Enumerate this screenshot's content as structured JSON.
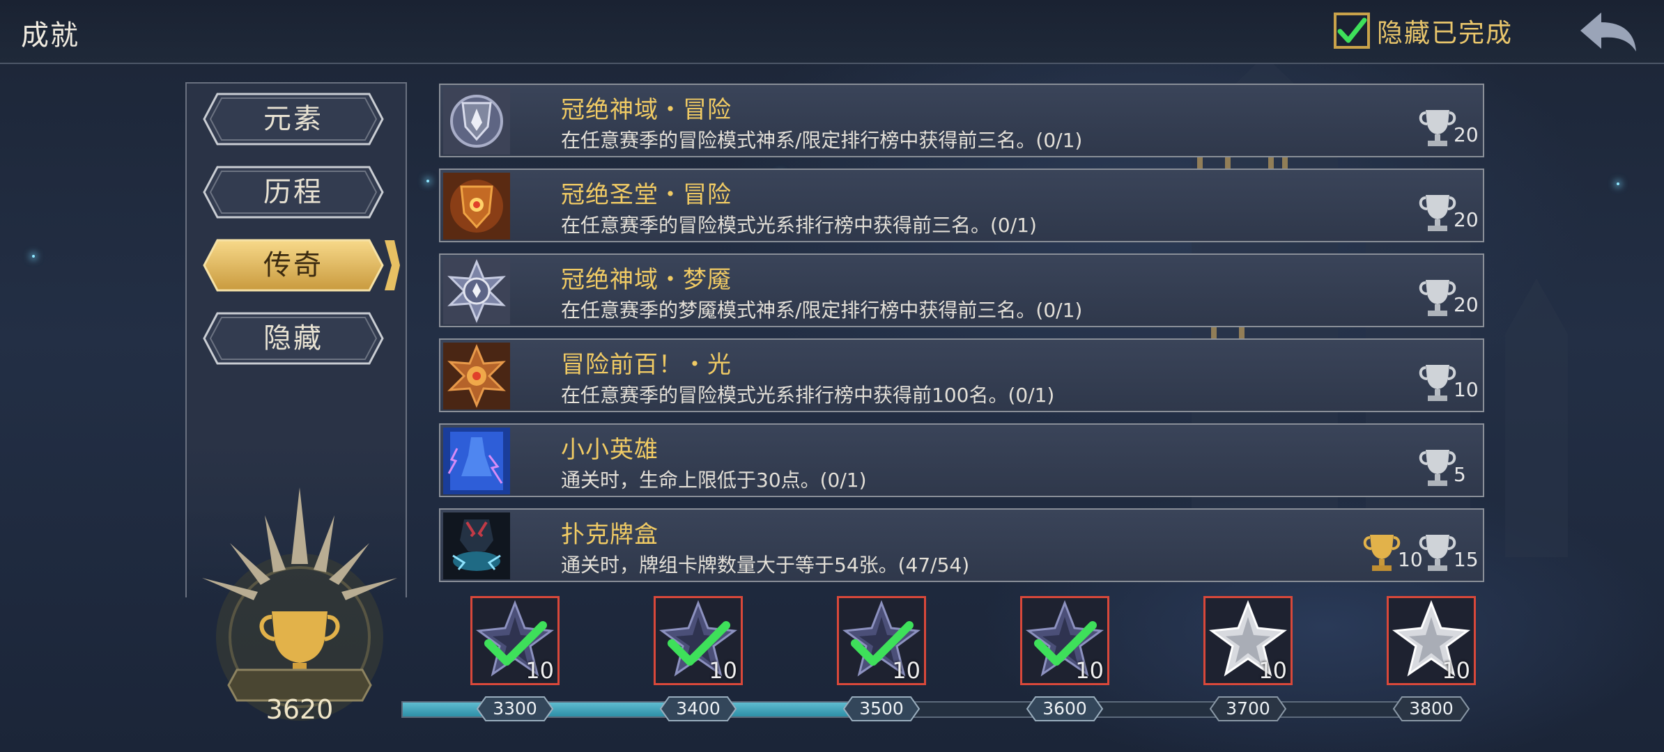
{
  "header": {
    "title": "成就",
    "hide_completed_label": "隐藏已完成",
    "hide_completed_checked": true
  },
  "categories": [
    {
      "label": "元素",
      "active": false
    },
    {
      "label": "历程",
      "active": false
    },
    {
      "label": "传奇",
      "active": true
    },
    {
      "label": "隐藏",
      "active": false
    }
  ],
  "total_score": "3620",
  "achievements": [
    {
      "name": "冠绝神域・冒险",
      "desc": "在任意赛季的冒险模式神系/限定排行榜中获得前三名。(0/1)",
      "icon": "divine-shield-medal-icon",
      "rewards": [
        {
          "type": "silver-trophy",
          "value": "20"
        }
      ]
    },
    {
      "name": "冠绝圣堂・冒险",
      "desc": "在任意赛季的冒险模式光系排行榜中获得前三名。(0/1)",
      "icon": "holy-shield-medal-icon",
      "rewards": [
        {
          "type": "silver-trophy",
          "value": "20"
        }
      ]
    },
    {
      "name": "冠绝神域・梦魇",
      "desc": "在任意赛季的梦魇模式神系/限定排行榜中获得前三名。(0/1)",
      "icon": "divine-star-medal-icon",
      "rewards": [
        {
          "type": "silver-trophy",
          "value": "20"
        }
      ]
    },
    {
      "name": "冒险前百！・光",
      "desc": "在任意赛季的冒险模式光系排行榜中获得前100名。(0/1)",
      "icon": "light-star-medal-icon",
      "rewards": [
        {
          "type": "silver-trophy",
          "value": "10"
        }
      ]
    },
    {
      "name": "小小英雄",
      "desc": "通关时，生命上限低于30点。(0/1)",
      "icon": "little-hero-card-icon",
      "rewards": [
        {
          "type": "silver-trophy",
          "value": "5"
        }
      ]
    },
    {
      "name": "扑克牌盒",
      "desc": "通关时，牌组卡牌数量大于等于54张。(47/54)",
      "icon": "card-box-icon",
      "rewards": [
        {
          "type": "gold-trophy",
          "value": "10"
        },
        {
          "type": "silver-trophy",
          "value": "15"
        }
      ]
    }
  ],
  "milestones": [
    {
      "threshold": "3300",
      "reward": "10",
      "claimed": true
    },
    {
      "threshold": "3400",
      "reward": "10",
      "claimed": true
    },
    {
      "threshold": "3500",
      "reward": "10",
      "claimed": true
    },
    {
      "threshold": "3600",
      "reward": "10",
      "claimed": true
    },
    {
      "threshold": "3700",
      "reward": "10",
      "claimed": false
    },
    {
      "threshold": "3800",
      "reward": "10",
      "claimed": false
    }
  ],
  "progress_fraction": 0.435,
  "colors": {
    "accent_gold": "#f1cb64",
    "check_green": "#3ee05a",
    "milestone_border": "#d9483a",
    "progress_fill": "#4aa8bf"
  }
}
